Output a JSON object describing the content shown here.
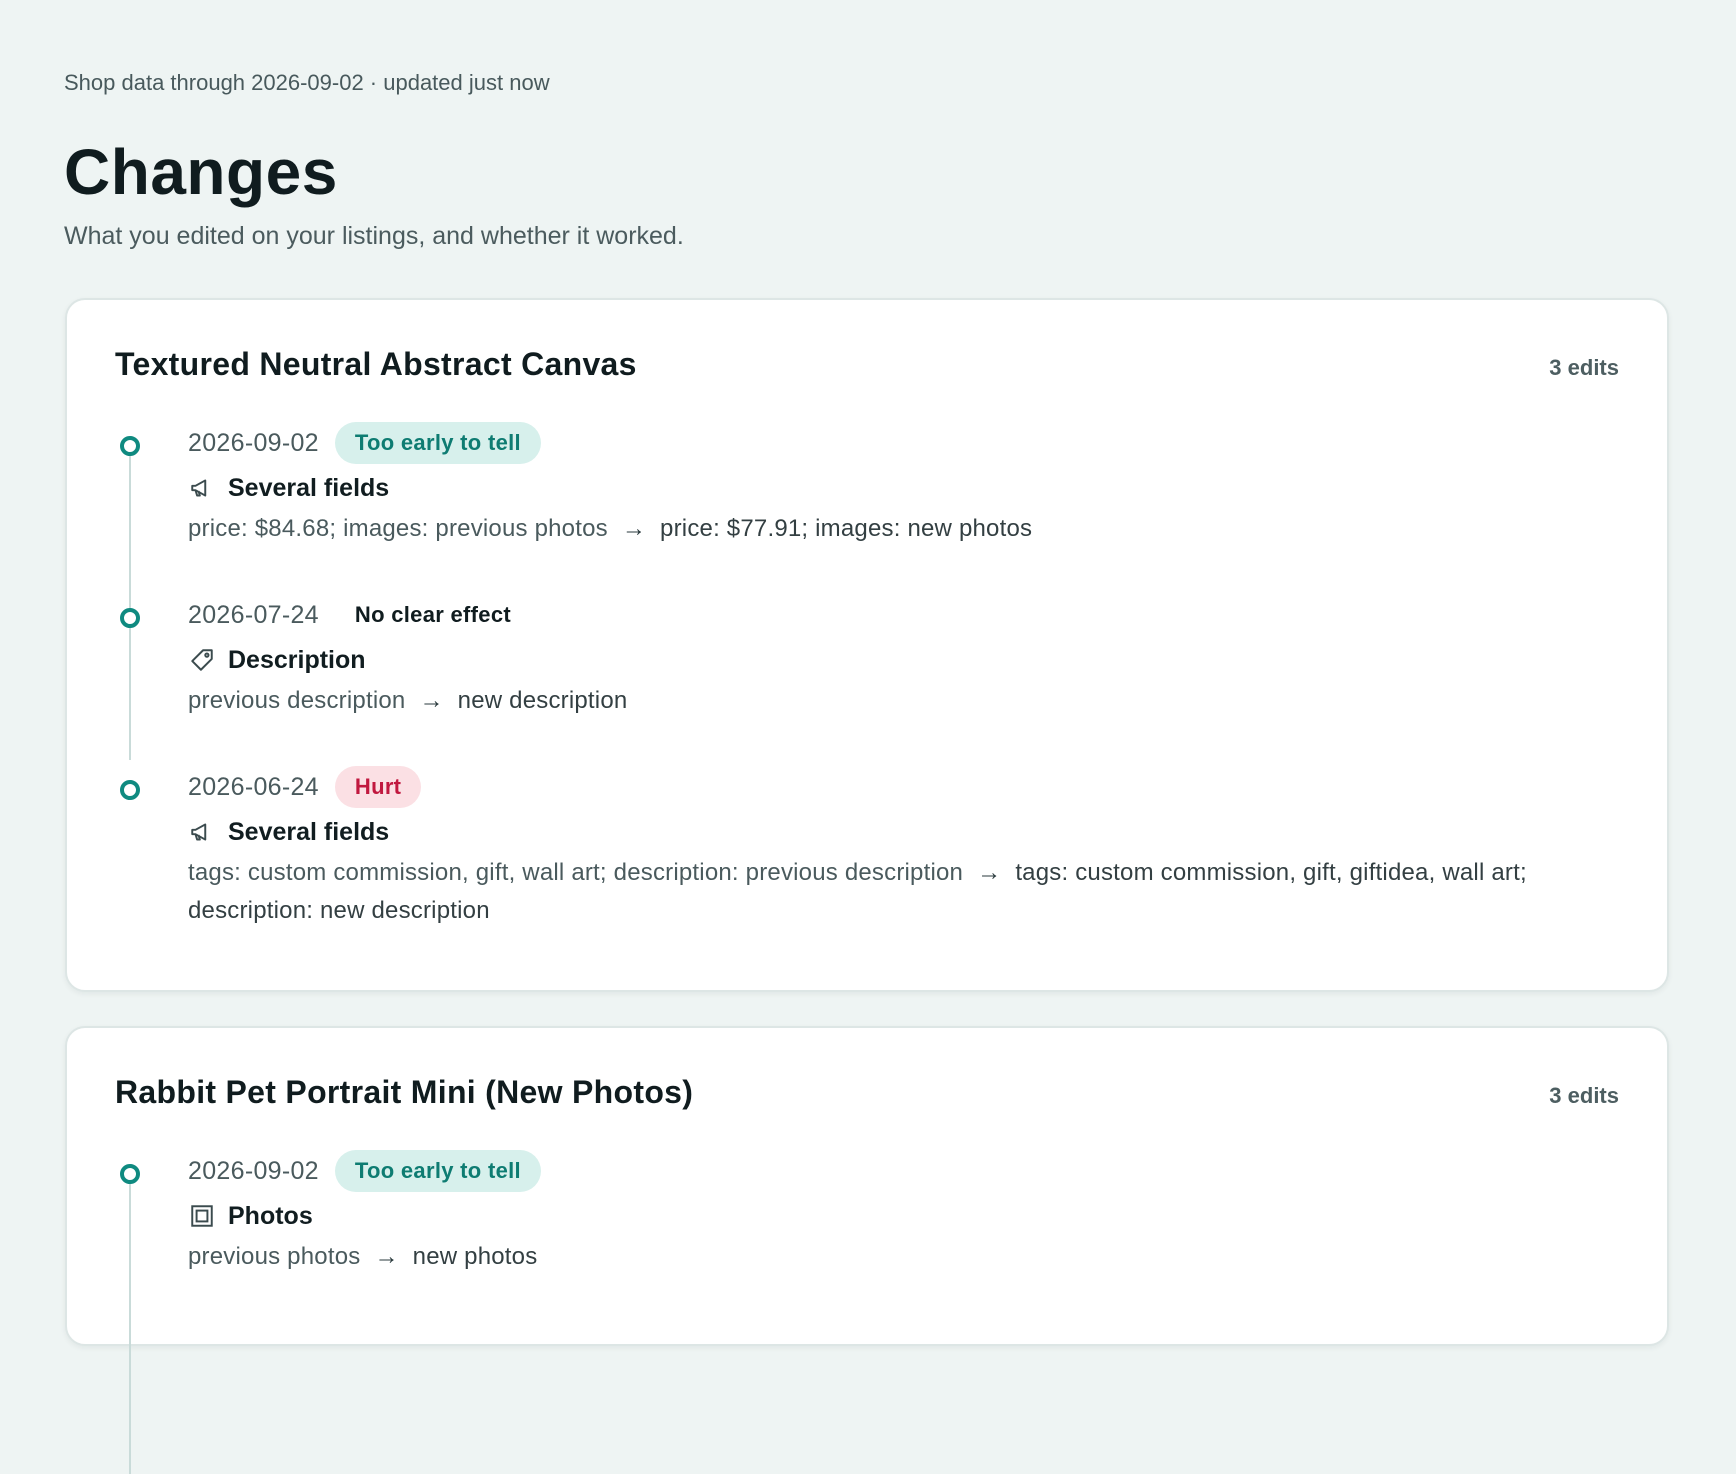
{
  "header": {
    "meta": "Shop data through 2026-09-02 · updated just now",
    "title": "Changes",
    "subtitle": "What you edited on your listings, and whether it worked."
  },
  "arrow_glyph": "→",
  "listings": [
    {
      "title": "Textured Neutral Abstract Canvas",
      "edit_count": "3 edits",
      "edits": [
        {
          "date": "2026-09-02",
          "outcome": "Too early to tell",
          "outcome_style": "early",
          "icon": "megaphone-icon",
          "field": "Several fields",
          "before": "price: $84.68; images: previous photos",
          "after": "price: $77.91; images: new photos"
        },
        {
          "date": "2026-07-24",
          "outcome": "No clear effect",
          "outcome_style": "none",
          "icon": "tag-icon",
          "field": "Description",
          "before": "previous description",
          "after": "new description"
        },
        {
          "date": "2026-06-24",
          "outcome": "Hurt",
          "outcome_style": "hurt",
          "icon": "megaphone-icon",
          "field": "Several fields",
          "before": "tags: custom commission, gift, wall art; description: previous description",
          "after": "tags: custom commission, gift, giftidea, wall art; description: new description"
        }
      ]
    },
    {
      "title": "Rabbit Pet Portrait Mini (New Photos)",
      "edit_count": "3 edits",
      "edits": [
        {
          "date": "2026-09-02",
          "outcome": "Too early to tell",
          "outcome_style": "early",
          "icon": "photo-frame-icon",
          "field": "Photos",
          "before": "previous photos",
          "after": "new photos"
        }
      ]
    }
  ],
  "colors": {
    "background": "#eef4f3",
    "accent": "#0f8a80",
    "early_bg": "#d7f0ec",
    "early_text": "#0e7c72",
    "hurt_bg": "#fbe0e4",
    "hurt_text": "#c1183f"
  }
}
